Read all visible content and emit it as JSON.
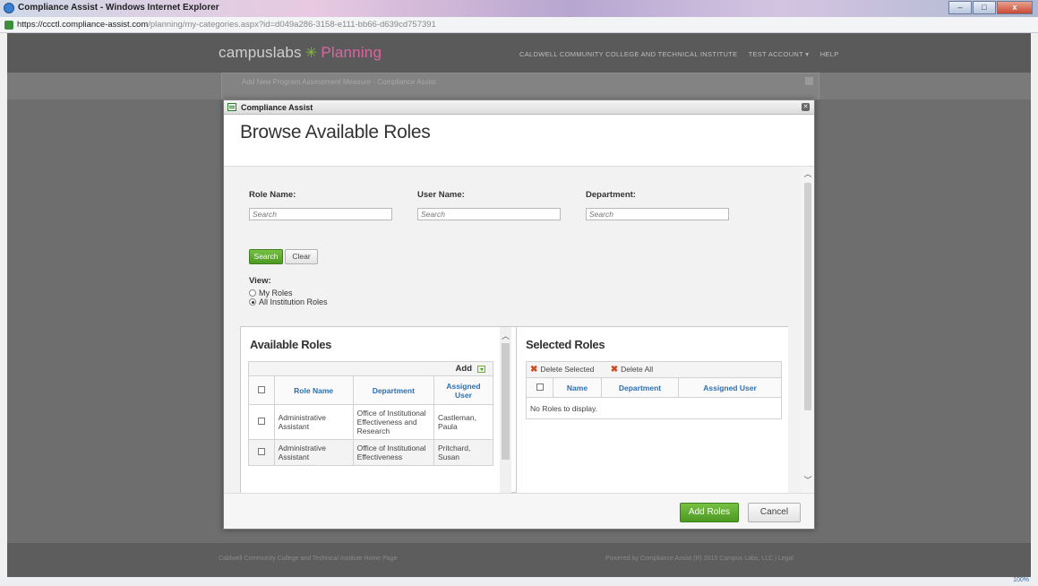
{
  "browser": {
    "window_title": "Compliance Assist - Windows Internet Explorer",
    "url_main": "https://ccctl.compliance-assist.com",
    "url_path": "/planning/my-categories.aspx?id=d049a286-3158-e111-bb66-d639cd757391",
    "zoom": "100%",
    "buttons": {
      "minimize": "–",
      "maximize": "□",
      "close": "x"
    }
  },
  "site_header": {
    "brand": "campuslabs",
    "module": "Planning",
    "links": [
      "CALDWELL COMMUNITY COLLEGE AND TECHNICAL INSTITUTE",
      "TEST ACCOUNT ▾",
      "HELP"
    ]
  },
  "background_dialog": {
    "title": "Add New Program Assessment Measure - Compliance Assist"
  },
  "footer": {
    "left": "Caldwell Community College and Technical Institute Home Page",
    "right": "Powered by Compliance Assist (R) 2015 Campus Labs, LLC | Legal"
  },
  "modal": {
    "title": "Compliance Assist",
    "heading": "Browse Available Roles",
    "search": {
      "role_name_label": "Role Name:",
      "user_name_label": "User Name:",
      "department_label": "Department:",
      "placeholder": "Search",
      "search_button": "Search",
      "clear_button": "Clear",
      "view_label": "View:",
      "view_options": [
        {
          "label": "My Roles",
          "checked": false
        },
        {
          "label": "All Institution Roles",
          "checked": true
        }
      ]
    },
    "available": {
      "title": "Available Roles",
      "add_label": "Add",
      "columns": [
        "Role Name",
        "Department",
        "Assigned User"
      ],
      "rows": [
        {
          "role": "Administrative Assistant",
          "department": "Office of Institutional Effectiveness and Research",
          "user": "Castleman, Paula"
        },
        {
          "role": "Administrative Assistant",
          "department": "Office of Institutional Effectiveness",
          "user": "Pritchard, Susan"
        }
      ]
    },
    "selected": {
      "title": "Selected Roles",
      "delete_selected": "Delete Selected",
      "delete_all": "Delete All",
      "columns": [
        "Name",
        "Department",
        "Assigned User"
      ],
      "empty_text": "No Roles to display."
    },
    "footer": {
      "add_roles": "Add Roles",
      "cancel": "Cancel"
    }
  }
}
